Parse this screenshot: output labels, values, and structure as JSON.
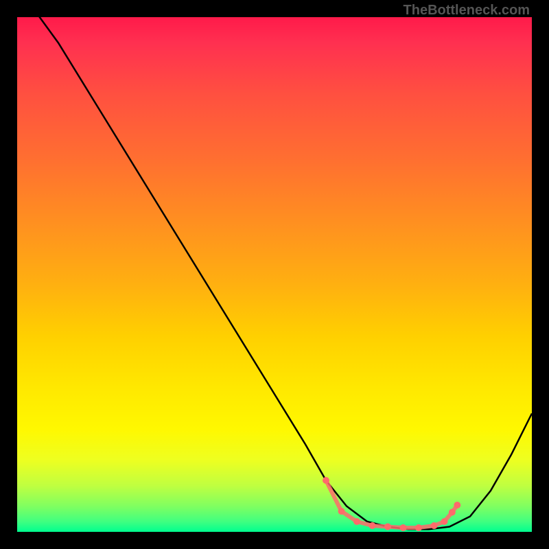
{
  "watermark": "TheBottleneck.com",
  "chart_data": {
    "type": "line",
    "title": "",
    "xlabel": "",
    "ylabel": "",
    "xlim": [
      0,
      100
    ],
    "ylim": [
      0,
      100
    ],
    "series": [
      {
        "name": "bottleneck-curve",
        "x": [
          0,
          8,
          16,
          24,
          32,
          40,
          48,
          56,
          60,
          64,
          68,
          72,
          76,
          80,
          84,
          88,
          92,
          96,
          100
        ],
        "y": [
          106,
          95,
          82,
          69,
          56,
          43,
          30,
          17,
          10,
          5,
          2,
          1,
          0.5,
          0.5,
          1,
          3,
          8,
          15,
          23
        ]
      }
    ],
    "markers": [
      {
        "x": 60,
        "y": 10
      },
      {
        "x": 63,
        "y": 4
      },
      {
        "x": 66,
        "y": 2
      },
      {
        "x": 69,
        "y": 1.2
      },
      {
        "x": 72,
        "y": 1
      },
      {
        "x": 75,
        "y": 0.8
      },
      {
        "x": 78,
        "y": 0.8
      },
      {
        "x": 81,
        "y": 1.2
      },
      {
        "x": 83,
        "y": 2
      },
      {
        "x": 84.5,
        "y": 3.8
      },
      {
        "x": 85.5,
        "y": 5.2
      }
    ],
    "marker_color": "#ff6b6b",
    "line_color": "#000000"
  }
}
